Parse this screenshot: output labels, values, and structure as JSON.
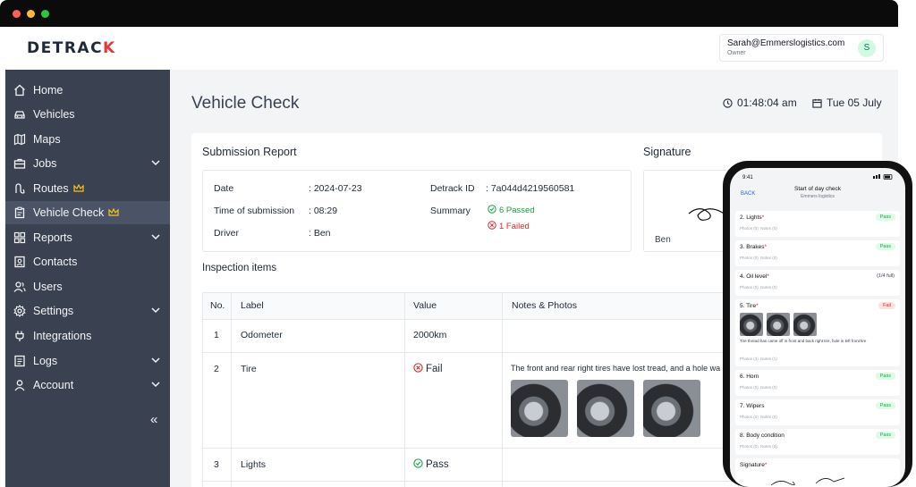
{
  "app": {
    "logo_main": "DETRAC",
    "logo_accent": "K"
  },
  "user": {
    "email": "Sarah@Emmerslogistics.com",
    "role": "Owner",
    "initial": "S"
  },
  "sidebar": {
    "items": [
      {
        "label": "Home",
        "icon": "home-icon"
      },
      {
        "label": "Vehicles",
        "icon": "car-icon"
      },
      {
        "label": "Maps",
        "icon": "map-icon"
      },
      {
        "label": "Jobs",
        "icon": "briefcase-icon",
        "chevron": true
      },
      {
        "label": "Routes",
        "icon": "route-icon",
        "crown": true
      },
      {
        "label": "Vehicle Check",
        "icon": "clipboard-icon",
        "crown": true,
        "active": true
      },
      {
        "label": "Reports",
        "icon": "grid-icon",
        "chevron": true
      },
      {
        "label": "Contacts",
        "icon": "contact-icon"
      },
      {
        "label": "Users",
        "icon": "users-icon"
      },
      {
        "label": "Settings",
        "icon": "gear-icon",
        "chevron": true
      },
      {
        "label": "Integrations",
        "icon": "plug-icon"
      },
      {
        "label": "Logs",
        "icon": "log-icon",
        "chevron": true
      },
      {
        "label": "Account",
        "icon": "person-icon",
        "chevron": true
      }
    ],
    "collapse_label": "«"
  },
  "page": {
    "title": "Vehicle Check",
    "time": "01:48:04 am",
    "date": "Tue 05 July"
  },
  "report": {
    "title": "Submission Report",
    "date_label": "Date",
    "date_value": ": 2024-07-23",
    "time_label": "Time of submission",
    "time_value": ": 08:29",
    "driver_label": "Driver",
    "driver_value": ": Ben",
    "id_label": "Detrack ID",
    "id_value": ": 7a044d4219560581",
    "summary_label": "Summary",
    "summary_passed": "6 Passed",
    "summary_failed": "1 Failed"
  },
  "signature": {
    "title": "Signature",
    "name": "Ben"
  },
  "inspection": {
    "title": "Inspection items",
    "columns": [
      "No.",
      "Label",
      "Value",
      "Notes & Photos"
    ],
    "rows": [
      {
        "no": "1",
        "label": "Odometer",
        "value": "2000km",
        "notes": ""
      },
      {
        "no": "2",
        "label": "Tire",
        "value": "Fail",
        "notes": "The front and rear right tires have lost tread, and a hole wa"
      },
      {
        "no": "3",
        "label": "Lights",
        "value": "Pass",
        "notes": ""
      }
    ]
  },
  "phone": {
    "status_time": "9:41",
    "back": "BACK",
    "title": "Start of day check",
    "subtitle": "Emmers logistics",
    "photos_0": "Photos (0)",
    "notes_0": "Notes (0)",
    "notes_1": "Notes (1)",
    "items": [
      {
        "label": "2. Lights",
        "status": "Pass"
      },
      {
        "label": "3. Brakes",
        "status": "Pass"
      },
      {
        "label": "4. Oil level",
        "value": "(1/4 full)"
      },
      {
        "label": "5. Tire",
        "status": "Fail",
        "photos": "Photos (3)",
        "note": "Tire thread has came off in front and back right tire, hole in left front tire"
      },
      {
        "label": "6. Horn",
        "status": "Pass"
      },
      {
        "label": "7. Wipers",
        "status": "Pass"
      },
      {
        "label": "8. Body condition",
        "status": "Pass"
      },
      {
        "label": "Signature"
      }
    ]
  }
}
